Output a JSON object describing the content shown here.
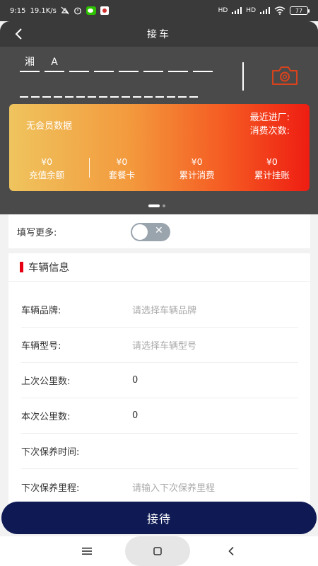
{
  "status_bar": {
    "time": "9:15",
    "speed": "19.1K/s",
    "network1": "HD",
    "network2": "HD",
    "battery": "77"
  },
  "nav": {
    "title": "接车"
  },
  "plate": {
    "province": "湘",
    "letter": "A",
    "slot_count_row1": 7,
    "slot_count_row2": 16
  },
  "member_card": {
    "no_data": "无会员数据",
    "recent_visit_label": "最近进厂:",
    "visit_count_label": "消费次数:",
    "stats": [
      {
        "value": "¥0",
        "label": "充值余额"
      },
      {
        "value": "¥0",
        "label": "套餐卡"
      },
      {
        "value": "¥0",
        "label": "累计消费"
      },
      {
        "value": "¥0",
        "label": "累计挂账"
      }
    ],
    "gradient_colors": [
      "#efc45e",
      "#ee1d12"
    ]
  },
  "more": {
    "label": "填写更多:",
    "toggle_on": false
  },
  "vehicle_info": {
    "title": "车辆信息",
    "rows": [
      {
        "label": "车辆品牌:",
        "value": "请选择车辆品牌",
        "placeholder": true
      },
      {
        "label": "车辆型号:",
        "value": "请选择车辆型号",
        "placeholder": true
      },
      {
        "label": "上次公里数:",
        "value": "0",
        "placeholder": false
      },
      {
        "label": "本次公里数:",
        "value": "0",
        "placeholder": false
      },
      {
        "label": "下次保养时间:",
        "value": "",
        "placeholder": false
      },
      {
        "label": "下次保养里程:",
        "value": "请输入下次保养里程",
        "placeholder": true
      }
    ]
  },
  "primary_button": {
    "label": "接待"
  },
  "colors": {
    "header_bg": "#3a3a3a",
    "plate_bg": "#4a4a4a",
    "accent_red": "#e60012",
    "button_navy": "#0f1a55",
    "camera_icon": "#d9431c"
  }
}
